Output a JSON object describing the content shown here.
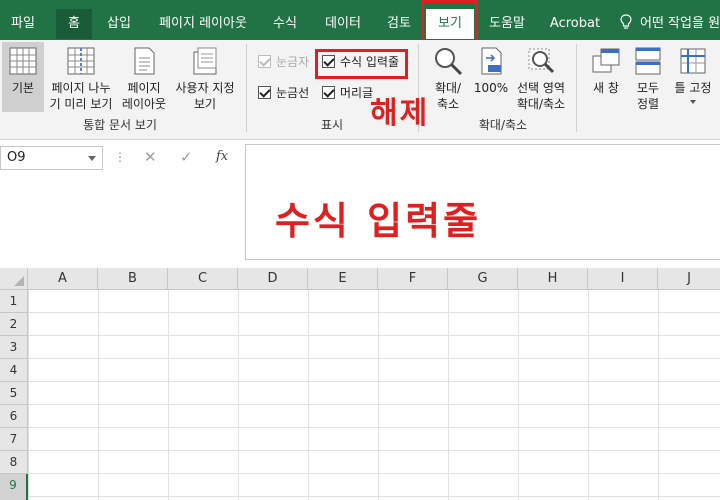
{
  "tabs": [
    {
      "label": "파일"
    },
    {
      "label": "홈"
    },
    {
      "label": "삽입"
    },
    {
      "label": "페이지 레이아웃"
    },
    {
      "label": "수식"
    },
    {
      "label": "데이터"
    },
    {
      "label": "검토"
    },
    {
      "label": "보기"
    },
    {
      "label": "도움말"
    },
    {
      "label": "Acrobat"
    }
  ],
  "tell_me": "어떤 작업을 원",
  "ribbon": {
    "workbook_views": {
      "normal": "기본",
      "page_break_line1": "페이지 나누",
      "page_break_line2": "기 미리 보기",
      "page_layout_line1": "페이지",
      "page_layout_line2": "레이아웃",
      "custom_line1": "사용자 지정",
      "custom_line2": "보기",
      "group_label": "통합 문서 보기"
    },
    "show": {
      "ruler": "눈금자",
      "formula_bar": "수식 입력줄",
      "gridlines": "눈금선",
      "headings": "머리글",
      "group_label": "표시"
    },
    "zoom": {
      "zoom_line1": "확대/",
      "zoom_line2": "축소",
      "zoom_100": "100%",
      "selection_line1": "선택 영역",
      "selection_line2": "확대/축소",
      "group_label": "확대/축소"
    },
    "window": {
      "new_window": "새 창",
      "arrange_line1": "모두",
      "arrange_line2": "정렬",
      "freeze": "틀 고정"
    }
  },
  "annotations": {
    "release": "해제",
    "formula_bar": "수식 입력줄"
  },
  "formula_bar": {
    "name_box": "O9",
    "fx": "fx",
    "cancel": "✕",
    "confirm": "✓",
    "dots": "⋮"
  },
  "columns": [
    "A",
    "B",
    "C",
    "D",
    "E",
    "F",
    "G",
    "H",
    "I",
    "J"
  ],
  "rows": [
    "1",
    "2",
    "3",
    "4",
    "5",
    "6",
    "7",
    "8",
    "9"
  ],
  "colors": {
    "accent": "#217346",
    "annotation": "#e02020"
  }
}
